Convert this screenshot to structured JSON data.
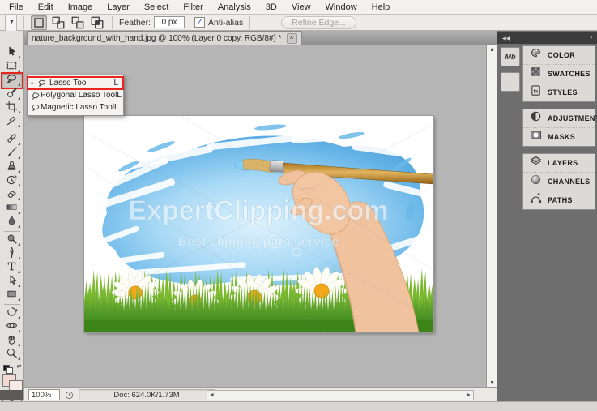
{
  "menu_bar": {
    "items": [
      "File",
      "Edit",
      "Image",
      "Layer",
      "Select",
      "Filter",
      "Analysis",
      "3D",
      "View",
      "Window",
      "Help"
    ]
  },
  "options_bar": {
    "tool_icon": "lasso-icon",
    "mode_icons": [
      "new-selection",
      "add-selection",
      "subtract-selection",
      "intersect-selection"
    ],
    "feather_label": "Feather:",
    "feather_value": "0 px",
    "anti_alias_label": "Anti-alias",
    "anti_alias_checked": "✓",
    "refine_edge_label": "Refine Edge..."
  },
  "document_tab": {
    "title": "nature_background_with_hand.jpg @ 100% (Layer 0 copy, RGB/8#) *",
    "close_glyph": "×"
  },
  "toolbar": {
    "tools": [
      {
        "name": "move",
        "icon": "move"
      },
      {
        "name": "rectangular-marquee",
        "icon": "marquee"
      },
      {
        "name": "lasso",
        "icon": "lasso",
        "active": true
      },
      {
        "name": "quick-selection",
        "icon": "quick-selection"
      },
      {
        "name": "crop",
        "icon": "crop"
      },
      {
        "name": "eyedropper",
        "icon": "eyedropper"
      },
      {
        "name": "spot-healing-brush",
        "icon": "healing",
        "group_end_before": true
      },
      {
        "name": "brush",
        "icon": "brush"
      },
      {
        "name": "clone-stamp",
        "icon": "clone-stamp"
      },
      {
        "name": "history-brush",
        "icon": "history-brush"
      },
      {
        "name": "eraser",
        "icon": "eraser"
      },
      {
        "name": "gradient",
        "icon": "gradient"
      },
      {
        "name": "blur",
        "icon": "blur"
      },
      {
        "name": "dodge",
        "icon": "dodge",
        "group_end_before": true
      },
      {
        "name": "pen",
        "icon": "pen"
      },
      {
        "name": "type",
        "icon": "type"
      },
      {
        "name": "path-selection",
        "icon": "path-selection"
      },
      {
        "name": "rectangle-shape",
        "icon": "shape"
      },
      {
        "name": "rotate-3d",
        "icon": "rotate-3d",
        "group_end_before": true
      },
      {
        "name": "orbit-3d",
        "icon": "orbit-3d"
      },
      {
        "name": "hand",
        "icon": "hand"
      },
      {
        "name": "zoom",
        "icon": "zoom"
      }
    ]
  },
  "flyout": {
    "items": [
      {
        "label": "Lasso Tool",
        "shortcut": "L",
        "icon": "lasso-small",
        "selected": true,
        "highlighted": true
      },
      {
        "label": "Polygonal Lasso Tool",
        "shortcut": "L",
        "icon": "polygonal-lasso"
      },
      {
        "label": "Magnetic Lasso Tool",
        "shortcut": "L",
        "icon": "magnetic-lasso"
      }
    ]
  },
  "canvas": {
    "watermark_title": "ExpertClipping.com",
    "watermark_subtitle": "Best clipping path service"
  },
  "status_bar": {
    "zoom": "100%",
    "doc_info": "Doc: 624.0K/1.73M",
    "menu_arrow": "▶"
  },
  "right_dock": {
    "header_collapse_glyph": "◀◀",
    "mini_bridge_label": "Mb",
    "panels": [
      {
        "label": "COLOR",
        "icon": "color",
        "group": 0
      },
      {
        "label": "SWATCHES",
        "icon": "swatches",
        "group": 0
      },
      {
        "label": "STYLES",
        "icon": "styles",
        "group": 0
      },
      {
        "label": "ADJUSTMENTS",
        "icon": "adjustments",
        "group": 1
      },
      {
        "label": "MASKS",
        "icon": "masks",
        "group": 1
      },
      {
        "label": "LAYERS",
        "icon": "layers",
        "group": 2
      },
      {
        "label": "CHANNELS",
        "icon": "channels",
        "group": 2
      },
      {
        "label": "PATHS",
        "icon": "paths",
        "group": 2
      }
    ]
  },
  "colors": {
    "highlight_red": "#e8261f",
    "canvas_surround": "#b5b5b5",
    "dock_gray": "#6e6e6e"
  }
}
